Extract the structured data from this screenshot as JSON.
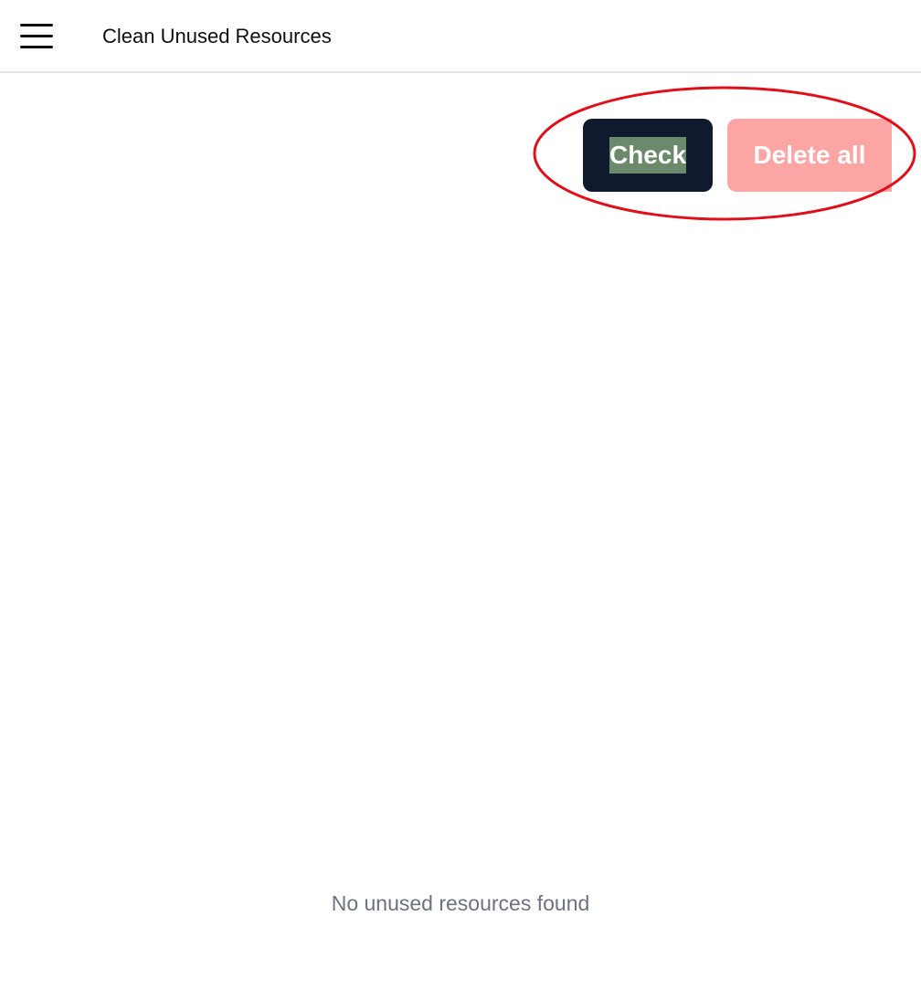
{
  "header": {
    "menu_icon": "hamburger-menu-icon",
    "title": "Clean Unused Resources"
  },
  "actions": {
    "check_label": "Check",
    "delete_all_label": "Delete all"
  },
  "main": {
    "empty_message": "No unused resources found"
  },
  "colors": {
    "check_button_bg": "#101a2e",
    "check_label_highlight": "#6b8a6b",
    "delete_button_bg": "#fba5a5",
    "annotation_circle": "#e0101a",
    "empty_text": "#6b7280"
  }
}
